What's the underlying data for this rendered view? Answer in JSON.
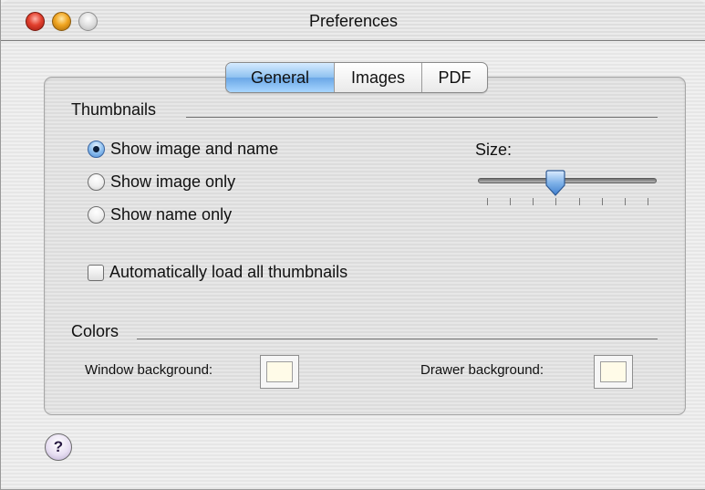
{
  "window": {
    "title": "Preferences"
  },
  "tabs": {
    "general": "General",
    "images": "Images",
    "pdf": "PDF",
    "selected": "General"
  },
  "thumbnails": {
    "group_label": "Thumbnails",
    "options": [
      {
        "label": "Show image and name",
        "selected": true
      },
      {
        "label": "Show image only",
        "selected": false
      },
      {
        "label": "Show name only",
        "selected": false
      }
    ],
    "size_label": "Size:",
    "size_slider": {
      "value": 4,
      "min": 1,
      "max": 8
    },
    "auto_load_label": "Automatically load all thumbnails",
    "auto_load_checked": false
  },
  "colors": {
    "group_label": "Colors",
    "window_background_label": "Window background:",
    "window_background_color": "#fffbe8",
    "drawer_background_label": "Drawer background:",
    "drawer_background_color": "#fffbe8"
  },
  "help": {
    "label": "?"
  }
}
